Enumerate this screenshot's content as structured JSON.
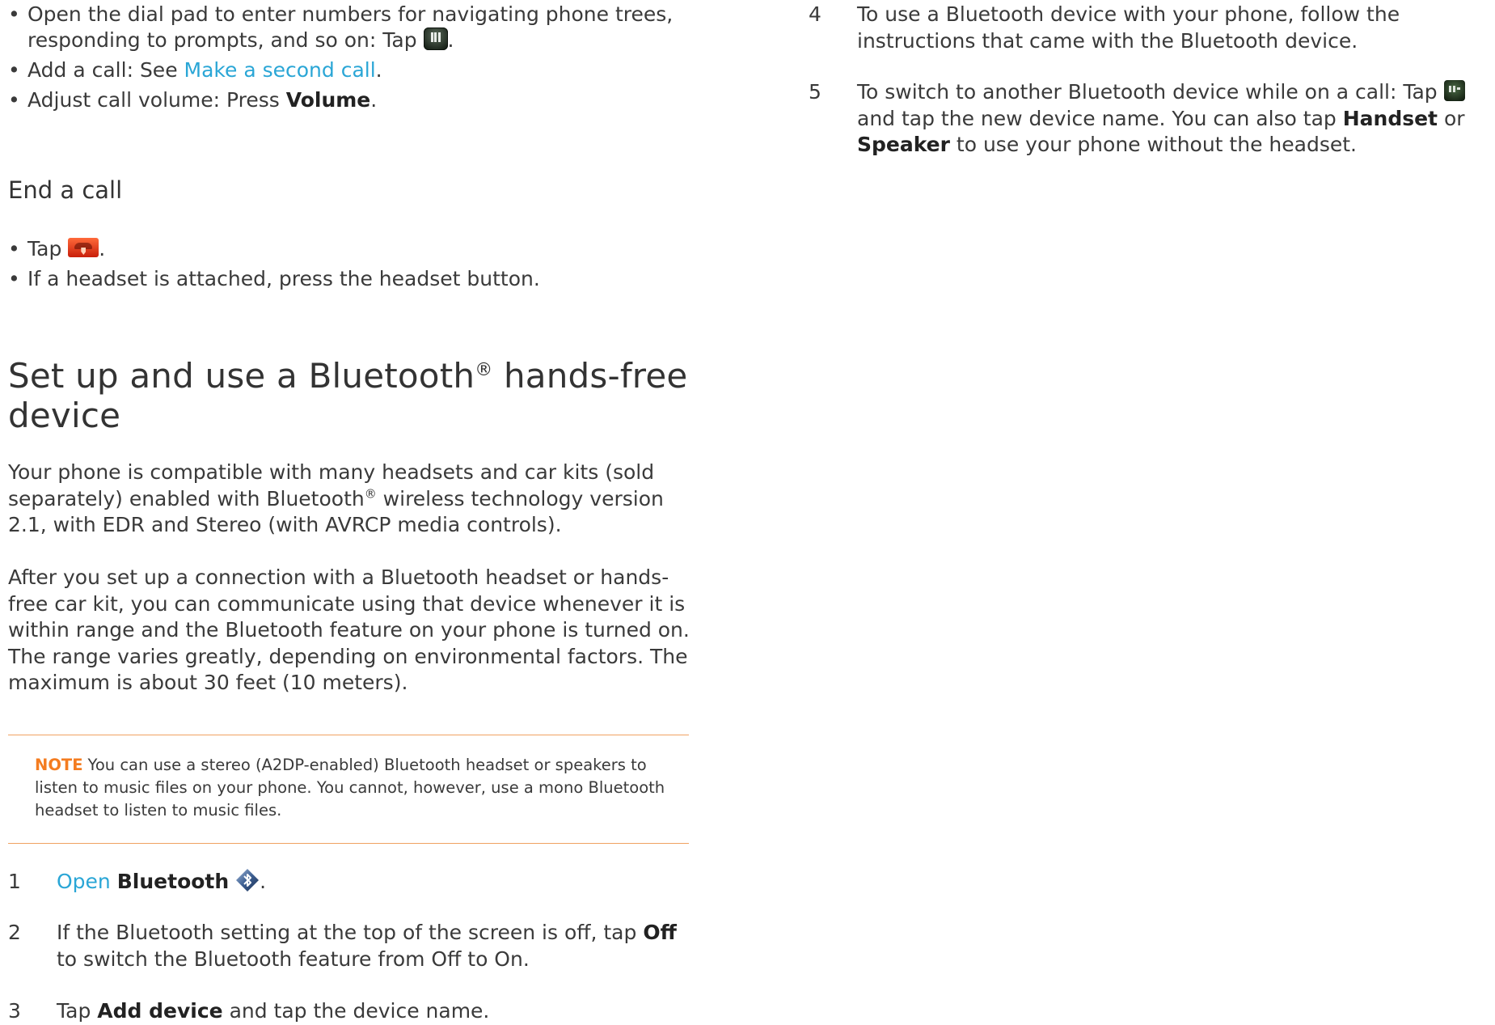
{
  "left": {
    "bullets_top": [
      {
        "prefix": "Open the dial pad to enter numbers for navigating phone trees, responding to prompts, and so on: Tap ",
        "icon": "dialpad-icon",
        "suffix": "."
      },
      {
        "prefix": "Add a call: See ",
        "link": "Make a second call",
        "suffix": "."
      },
      {
        "prefix": "Adjust call volume: Press ",
        "bold": "Volume",
        "suffix": "."
      }
    ],
    "end_call": {
      "title": "End a call",
      "bullets": [
        {
          "prefix": "Tap ",
          "icon": "end-call-icon",
          "suffix": "."
        },
        {
          "text": "If a headset is attached, press the headset button."
        }
      ]
    },
    "bluetooth_section": {
      "title_part1": "Set up and use a Bluetooth",
      "title_reg": "®",
      "title_part2": " hands-free device",
      "para1_part1": "Your phone is compatible with many headsets and car kits (sold separately) enabled with Bluetooth",
      "para1_reg": "®",
      "para1_part2": " wireless technology version 2.1, with EDR and Stereo (with AVRCP media controls).",
      "para2": "After you set up a connection with a Bluetooth headset or hands-free car kit, you can communicate using that device whenever it is within range and the Bluetooth feature on your phone is turned on. The range varies greatly, depending on environmental factors. The maximum is about 30 feet (10 meters).",
      "note_label": "NOTE",
      "note_text": "You can use a stereo (A2DP-enabled) Bluetooth headset or speakers to listen to music files on your phone. You cannot, however, use a mono Bluetooth headset to listen to music files.",
      "steps": [
        {
          "num": "1",
          "link": "Open",
          "bold": "Bluetooth",
          "suffix": "."
        },
        {
          "num": "2",
          "prefix": "If the Bluetooth setting at the top of the screen is off, tap ",
          "bold": "Off",
          "suffix": " to switch the Bluetooth feature from Off to On."
        },
        {
          "num": "3",
          "prefix": "Tap ",
          "bold": "Add device",
          "suffix": " and tap the device name."
        }
      ]
    }
  },
  "right": {
    "steps": [
      {
        "num": "4",
        "text": "To use a Bluetooth device with your phone, follow the instructions that came with the Bluetooth device."
      },
      {
        "num": "5",
        "prefix": "To switch to another Bluetooth device while on a call: Tap ",
        "icon": "audio-source-icon",
        "middle": " and tap the new device name. You can also tap ",
        "bold1": "Handset",
        "or": " or ",
        "bold2": "Speaker",
        "suffix": " to use your phone without the headset."
      }
    ]
  }
}
